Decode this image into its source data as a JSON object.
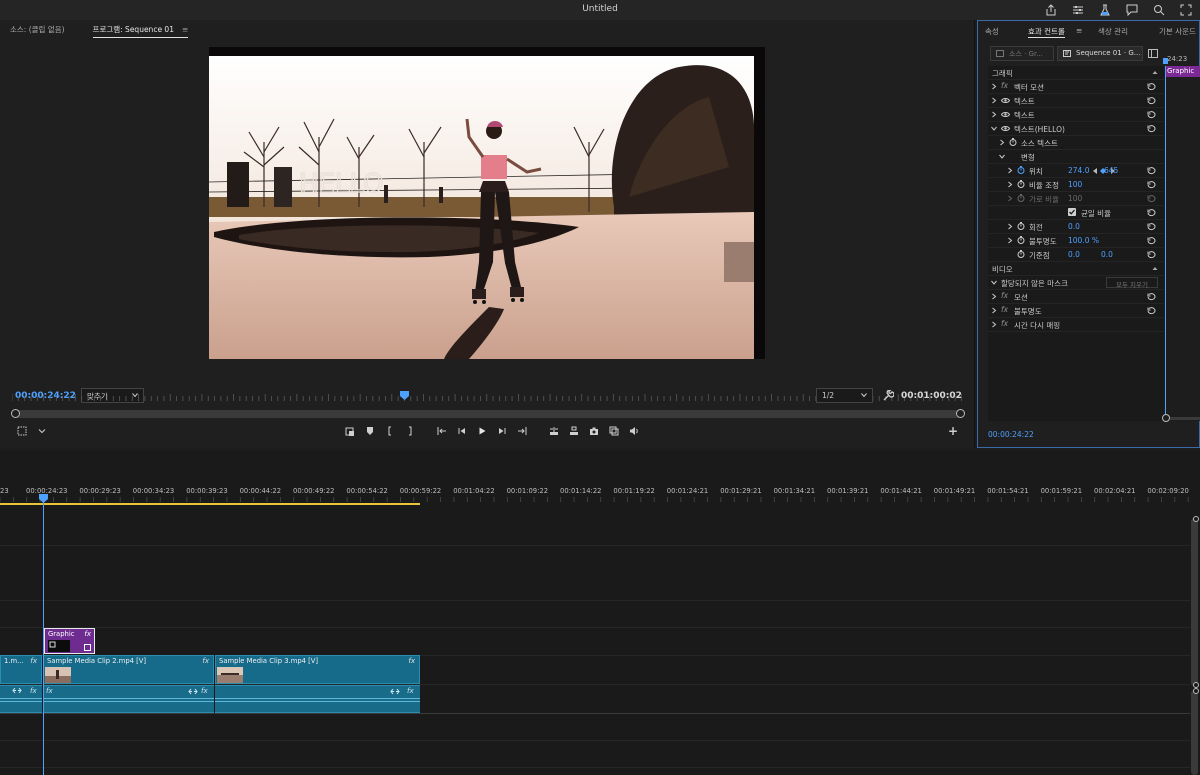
{
  "window": {
    "title": "Untitled",
    "icons": [
      "share-icon",
      "settings-sliders-icon",
      "beaker-icon",
      "comment-icon",
      "search-icon",
      "expand-icon"
    ]
  },
  "program_monitor": {
    "tabs": [
      {
        "label": "소스: (클립 없음)",
        "active": false
      },
      {
        "label": "프로그램: Sequence 01",
        "active": true
      }
    ],
    "tab_menu_symbol": "≡",
    "video_overlay_text": "HELLO",
    "current_timecode": "00:00:24:22",
    "zoom_select": "맞추기",
    "resolution_select": "1/2",
    "duration_timecode": "00:01:00:02",
    "add_symbol": "+",
    "mini_playhead_fraction": 0.41
  },
  "effect_controls": {
    "tabs": [
      {
        "label": "속성",
        "active": false
      },
      {
        "label": "효과 컨트롤",
        "active": true
      },
      {
        "label": "≡",
        "active": false
      },
      {
        "label": "색상 관리",
        "active": false
      },
      {
        "label": "기본 사운드",
        "active": false
      }
    ],
    "source_chip": "소스 · Gr...",
    "sequence_chip": "Sequence 01 · G...",
    "timeline_tc": "24:23",
    "timeline_clip": "Graphic",
    "section_graphics": "그래픽",
    "rows": {
      "vector_motion": "벡터 모션",
      "text1": "텍스트",
      "text2": "텍스트",
      "text_hello": "텍스트(HELLO)",
      "source_text": "소스 텍스트",
      "transform": "변형",
      "position": "위치",
      "position_x": "274.0",
      "position_y": "645",
      "scale": "비율 조정",
      "scale_val": "100",
      "scale_width": "가로 비율",
      "scale_width_val": "100",
      "uniform_scale": "균일 비율",
      "rotation": "회전",
      "rotation_val": "0.0",
      "opacity": "불투명도",
      "opacity_val": "100.0 %",
      "anchor": "기준점",
      "anchor_x": "0.0",
      "anchor_y": "0.0"
    },
    "section_video": "비디오",
    "mask_row": "할당되지 않은 마스크",
    "mask_clear": "모두 지우기",
    "motion": "모션",
    "opacity2": "불투명도",
    "time_remap": "시간 다시 매핑",
    "fx_label": "fx",
    "footer_tc": "00:00:24:22"
  },
  "timeline": {
    "ruler_labels": [
      "23",
      "00:00:24:23",
      "00:00:29:23",
      "00:00:34:23",
      "00:00:39:23",
      "00:00:44:22",
      "00:00:49:22",
      "00:00:54:22",
      "00:00:59:22",
      "00:01:04:22",
      "00:01:09:22",
      "00:01:14:22",
      "00:01:19:22",
      "00:01:24:21",
      "00:01:29:21",
      "00:01:34:21",
      "00:01:39:21",
      "00:01:44:21",
      "00:01:49:21",
      "00:01:54:21",
      "00:01:59:21",
      "00:02:04:21",
      "00:02:09:20"
    ],
    "graphic_clip": {
      "name": "Graphic",
      "fx": "fx"
    },
    "video_clips": [
      {
        "name": "1.m...",
        "fx": "fx"
      },
      {
        "name": "Sample Media Clip 2.mp4 [V]",
        "fx": "fx"
      },
      {
        "name": "Sample Media Clip 3.mp4 [V]",
        "fx": "fx"
      }
    ],
    "audio_fx": "fx"
  },
  "colors": {
    "accent_blue": "#4ea1ff",
    "clip_video": "#166b8a",
    "clip_graphic": "#6f2c90",
    "work_area": "#e6c53a"
  }
}
